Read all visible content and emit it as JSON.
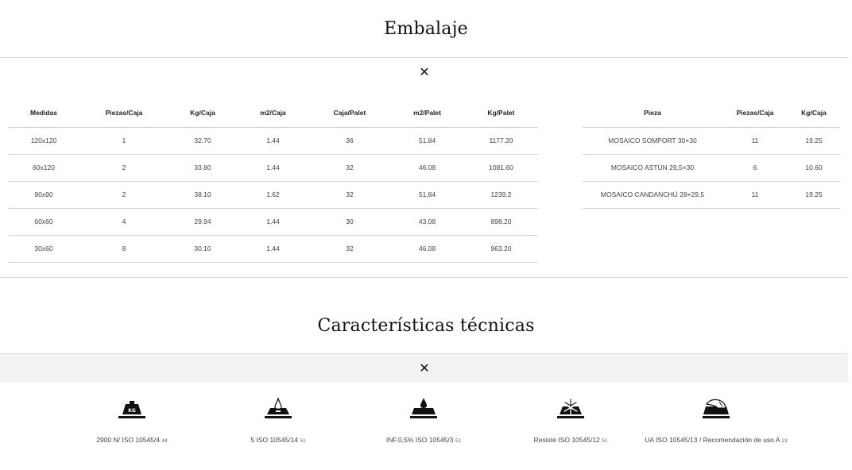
{
  "embalaje": {
    "title": "Embalaje",
    "close_symbol": "✕",
    "sizes_table": {
      "headers": [
        "Medidas",
        "Piezas/Caja",
        "Kg/Caja",
        "m2/Caja",
        "Caja/Palet",
        "m2/Palet",
        "Kg/Palet"
      ],
      "rows": [
        [
          "120x120",
          "1",
          "32.70",
          "1.44",
          "36",
          "51.84",
          "1177.20"
        ],
        [
          "60x120",
          "2",
          "33.80",
          "1.44",
          "32",
          "46.08",
          "1081.60"
        ],
        [
          "90x90",
          "2",
          "38.10",
          "1.62",
          "32",
          "51,84",
          "1239.2"
        ],
        [
          "60x60",
          "4",
          "29.94",
          "1.44",
          "30",
          "43.08",
          "898.20"
        ],
        [
          "30x60",
          "8",
          "30.10",
          "1.44",
          "32",
          "46.08",
          "963.20"
        ]
      ]
    },
    "pieces_table": {
      "headers": [
        "Pieza",
        "Piezas/Caja",
        "Kg/Caja"
      ],
      "rows": [
        [
          "MOSAICO SOMPORT 30×30",
          "11",
          "19.25"
        ],
        [
          "MOSAICO ASTÚN 29,5×30",
          "6",
          "10.60"
        ],
        [
          "MOSAICO CANDANCHÚ 28×29,5",
          "11",
          "19.25"
        ]
      ]
    }
  },
  "caracteristicas": {
    "title": "Características técnicas",
    "close_symbol": "✕",
    "features": [
      {
        "icon": "weight-kg-icon",
        "kg_text": "KG",
        "label": "2900 N/ ISO 10545/4",
        "note": "44"
      },
      {
        "icon": "water-drop-icon",
        "label": "5 ISO 10545/14",
        "note": "51"
      },
      {
        "icon": "absorption-drop-icon",
        "label": "INF.0,5% ISO 10545/3",
        "note": "51"
      },
      {
        "icon": "snowflake-icon",
        "label": "Resiste ISO 10545/12",
        "note": "51"
      },
      {
        "icon": "slip-resistance-icon",
        "label": "UA ISO 10545/13 / Recomendación de uso A",
        "note": "23"
      }
    ]
  }
}
